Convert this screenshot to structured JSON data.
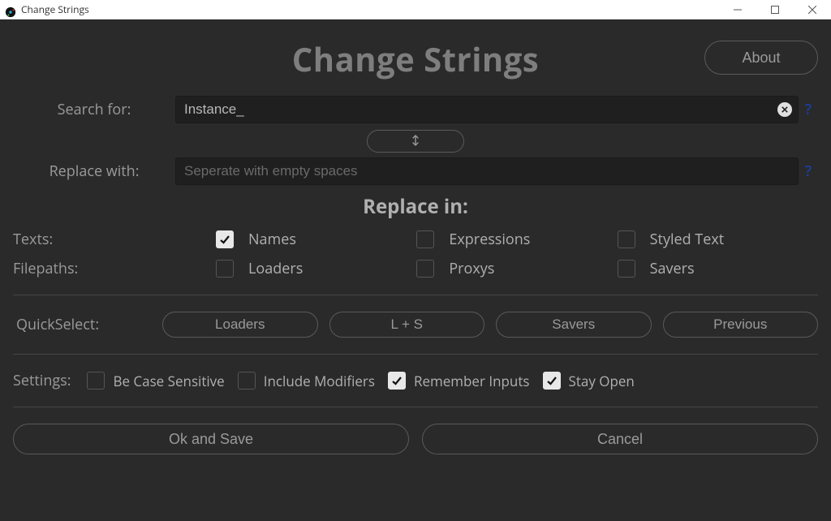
{
  "window": {
    "title": "Change Strings"
  },
  "header": {
    "title": "Change Strings",
    "about": "About"
  },
  "io": {
    "search_label": "Search for:",
    "search_value": "Instance_",
    "replace_label": "Replace with:",
    "replace_value": "",
    "replace_placeholder": "Seperate with empty spaces",
    "help_glyph": "?"
  },
  "replace_in": {
    "title": "Replace in:",
    "texts_label": "Texts:",
    "filepaths_label": "Filepaths:",
    "texts": {
      "names": {
        "label": "Names",
        "checked": true
      },
      "expressions": {
        "label": "Expressions",
        "checked": false
      },
      "styled_text": {
        "label": "Styled Text",
        "checked": false
      }
    },
    "filepaths": {
      "loaders": {
        "label": "Loaders",
        "checked": false
      },
      "proxys": {
        "label": "Proxys",
        "checked": false
      },
      "savers": {
        "label": "Savers",
        "checked": false
      }
    }
  },
  "quick_select": {
    "label": "QuickSelect:",
    "loaders": "Loaders",
    "l_plus_s": "L + S",
    "savers": "Savers",
    "previous": "Previous"
  },
  "settings": {
    "label": "Settings:",
    "case_sensitive": {
      "label": "Be Case Sensitive",
      "checked": false
    },
    "include_modifiers": {
      "label": "Include Modifiers",
      "checked": false
    },
    "remember_inputs": {
      "label": "Remember Inputs",
      "checked": true
    },
    "stay_open": {
      "label": "Stay Open",
      "checked": true
    }
  },
  "footer": {
    "ok": "Ok and Save",
    "cancel": "Cancel"
  }
}
